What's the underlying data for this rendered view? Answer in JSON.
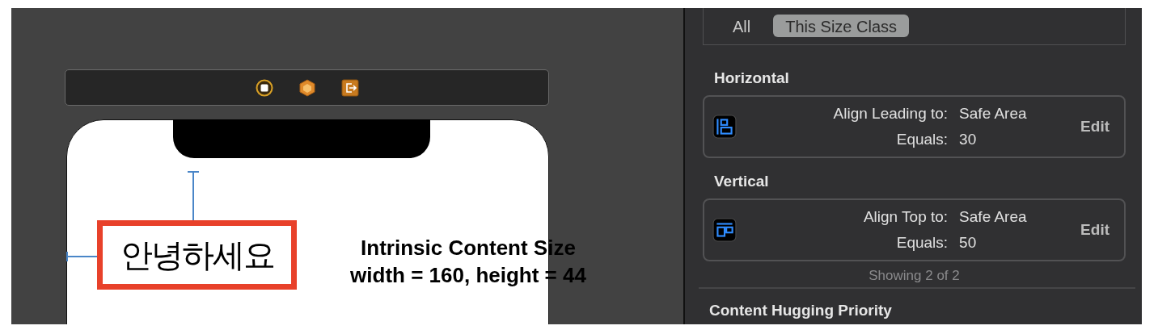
{
  "canvas": {
    "label_text": "안녕하세요",
    "annotation": [
      "Intrinsic Content Size",
      "width = 160, height = 44"
    ]
  },
  "inspector": {
    "filter_tabs": [
      {
        "label": "All",
        "selected": false
      },
      {
        "label": "This Size Class",
        "selected": true
      }
    ],
    "sections": [
      {
        "heading": "Horizontal",
        "constraint": {
          "kind": "leading",
          "relation": "Align Leading to:",
          "target": "Safe Area",
          "equals_label": "Equals:",
          "equals_value": "30",
          "action": "Edit"
        }
      },
      {
        "heading": "Vertical",
        "constraint": {
          "kind": "top",
          "relation": "Align Top to:",
          "target": "Safe Area",
          "equals_label": "Equals:",
          "equals_value": "50",
          "action": "Edit"
        }
      }
    ],
    "footer": "Showing 2 of 2",
    "next_heading": "Content Hugging Priority"
  }
}
